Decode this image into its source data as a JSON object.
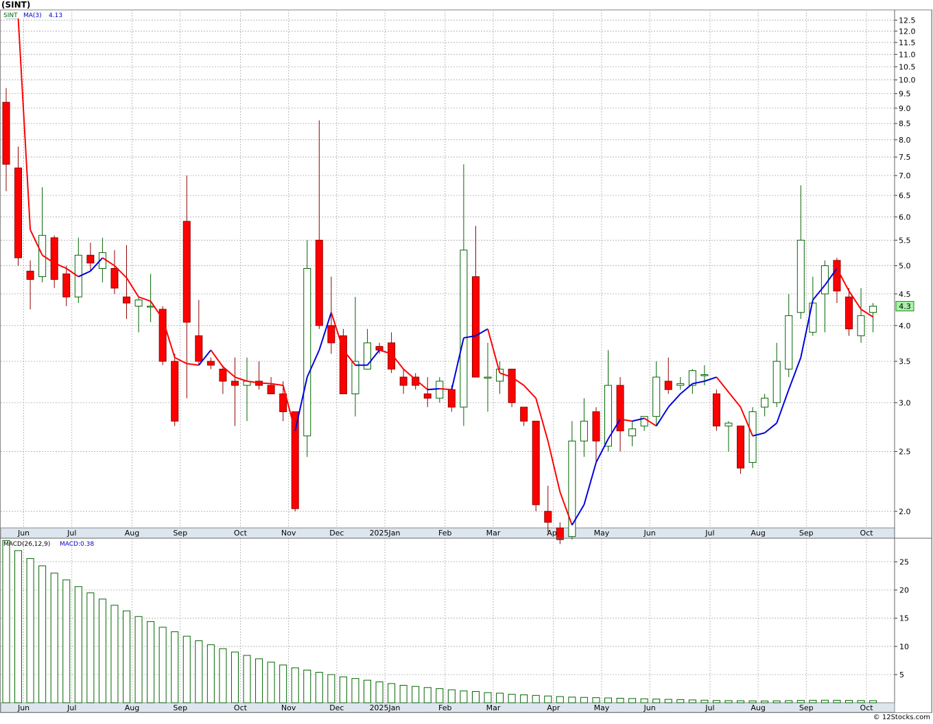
{
  "header": {
    "title": "(SINT)"
  },
  "footer": {
    "credit": "© 12Stocks.com"
  },
  "colors": {
    "up_fill": "#ffffff",
    "up_stroke": "#006400",
    "down_fill": "#ff0000",
    "down_stroke": "#8b0000",
    "ma_down": "#ff0000",
    "ma_up": "#0000dd",
    "macd_bar": "#006400",
    "grid": "#aaaaaa",
    "axis_bg": "#dde6ee",
    "last_price_bg": "#a8f0a8"
  },
  "chart_data": [
    {
      "type": "candlestick",
      "scale": "log",
      "legend": {
        "symbol": "SINT",
        "ma_label": "MA(3)",
        "ma_value": "4.13"
      },
      "last_price": "4.3",
      "ylim": [
        1.88,
        13.0
      ],
      "y_ticks": [
        "12.5",
        "12.0",
        "11.5",
        "11.0",
        "10.5",
        "10.0",
        "9.5",
        "9.0",
        "8.5",
        "8.0",
        "7.5",
        "7.0",
        "6.5",
        "6.0",
        "5.5",
        "5.0",
        "4.5",
        "4.0",
        "3.5",
        "3.0",
        "2.5",
        "2.0"
      ],
      "x_tick_labels": [
        "Jun",
        "Jul",
        "Aug",
        "Sep",
        "Oct",
        "Nov",
        "Dec",
        "2025Jan",
        "Feb",
        "Mar",
        "Apr",
        "May",
        "Jun",
        "Jul",
        "Aug",
        "Sep",
        "Oct"
      ],
      "x_tick_index": [
        1,
        5,
        10,
        14,
        19,
        23,
        27,
        31,
        36,
        40,
        45,
        49,
        53,
        58,
        62,
        66,
        71
      ],
      "candles": [
        {
          "o": 9.2,
          "h": 9.7,
          "l": 6.6,
          "c": 7.3
        },
        {
          "o": 7.2,
          "h": 7.8,
          "l": 5.0,
          "c": 5.15
        },
        {
          "o": 4.9,
          "h": 5.1,
          "l": 4.25,
          "c": 4.75
        },
        {
          "o": 4.8,
          "h": 6.7,
          "l": 4.7,
          "c": 5.6
        },
        {
          "o": 5.55,
          "h": 5.6,
          "l": 4.6,
          "c": 4.75
        },
        {
          "o": 4.85,
          "h": 5.0,
          "l": 4.3,
          "c": 4.45
        },
        {
          "o": 4.45,
          "h": 5.55,
          "l": 4.35,
          "c": 5.2
        },
        {
          "o": 5.2,
          "h": 5.45,
          "l": 4.9,
          "c": 5.05
        },
        {
          "o": 4.95,
          "h": 5.55,
          "l": 4.7,
          "c": 5.25
        },
        {
          "o": 4.95,
          "h": 5.3,
          "l": 4.5,
          "c": 4.6
        },
        {
          "o": 4.45,
          "h": 5.4,
          "l": 4.1,
          "c": 4.35
        },
        {
          "o": 4.3,
          "h": 4.45,
          "l": 3.9,
          "c": 4.4
        },
        {
          "o": 4.3,
          "h": 4.85,
          "l": 4.05,
          "c": 4.3
        },
        {
          "o": 4.25,
          "h": 4.3,
          "l": 3.45,
          "c": 3.5
        },
        {
          "o": 3.5,
          "h": 3.6,
          "l": 2.75,
          "c": 2.8
        },
        {
          "o": 5.9,
          "h": 7.0,
          "l": 3.05,
          "c": 4.05
        },
        {
          "o": 3.85,
          "h": 4.4,
          "l": 3.45,
          "c": 3.5
        },
        {
          "o": 3.5,
          "h": 3.55,
          "l": 3.4,
          "c": 3.45
        },
        {
          "o": 3.4,
          "h": 3.45,
          "l": 3.1,
          "c": 3.25
        },
        {
          "o": 3.25,
          "h": 3.55,
          "l": 2.75,
          "c": 3.2
        },
        {
          "o": 3.2,
          "h": 3.55,
          "l": 2.8,
          "c": 3.25
        },
        {
          "o": 3.25,
          "h": 3.5,
          "l": 3.15,
          "c": 3.2
        },
        {
          "o": 3.2,
          "h": 3.3,
          "l": 3.1,
          "c": 3.1
        },
        {
          "o": 3.1,
          "h": 3.25,
          "l": 2.8,
          "c": 2.9
        },
        {
          "o": 2.9,
          "h": 2.9,
          "l": 2.0,
          "c": 2.02
        },
        {
          "o": 2.65,
          "h": 5.5,
          "l": 2.45,
          "c": 4.95
        },
        {
          "o": 5.5,
          "h": 8.6,
          "l": 3.95,
          "c": 4.0
        },
        {
          "o": 4.0,
          "h": 4.8,
          "l": 3.6,
          "c": 3.75
        },
        {
          "o": 3.85,
          "h": 3.95,
          "l": 3.1,
          "c": 3.1
        },
        {
          "o": 3.1,
          "h": 4.45,
          "l": 2.85,
          "c": 3.5
        },
        {
          "o": 3.4,
          "h": 3.95,
          "l": 3.4,
          "c": 3.75
        },
        {
          "o": 3.7,
          "h": 3.75,
          "l": 3.6,
          "c": 3.65
        },
        {
          "o": 3.75,
          "h": 3.9,
          "l": 3.35,
          "c": 3.4
        },
        {
          "o": 3.3,
          "h": 3.4,
          "l": 3.1,
          "c": 3.2
        },
        {
          "o": 3.3,
          "h": 3.35,
          "l": 3.15,
          "c": 3.2
        },
        {
          "o": 3.1,
          "h": 3.3,
          "l": 2.95,
          "c": 3.05
        },
        {
          "o": 3.05,
          "h": 3.3,
          "l": 3.0,
          "c": 3.25
        },
        {
          "o": 3.15,
          "h": 3.2,
          "l": 2.9,
          "c": 2.95
        },
        {
          "o": 2.95,
          "h": 7.3,
          "l": 2.75,
          "c": 5.3
        },
        {
          "o": 4.8,
          "h": 5.8,
          "l": 3.3,
          "c": 3.3
        },
        {
          "o": 3.3,
          "h": 3.75,
          "l": 2.9,
          "c": 3.3
        },
        {
          "o": 3.25,
          "h": 3.5,
          "l": 3.1,
          "c": 3.4
        },
        {
          "o": 3.4,
          "h": 3.4,
          "l": 2.95,
          "c": 3.0
        },
        {
          "o": 2.95,
          "h": 2.95,
          "l": 2.75,
          "c": 2.8
        },
        {
          "o": 2.8,
          "h": 2.8,
          "l": 2.0,
          "c": 2.05
        },
        {
          "o": 2.0,
          "h": 2.2,
          "l": 1.85,
          "c": 1.92
        },
        {
          "o": 1.88,
          "h": 1.92,
          "l": 1.77,
          "c": 1.8
        },
        {
          "o": 1.82,
          "h": 2.8,
          "l": 1.8,
          "c": 2.6
        },
        {
          "o": 2.6,
          "h": 3.05,
          "l": 2.45,
          "c": 2.8
        },
        {
          "o": 2.9,
          "h": 2.95,
          "l": 2.4,
          "c": 2.6
        },
        {
          "o": 2.55,
          "h": 3.65,
          "l": 2.5,
          "c": 3.2
        },
        {
          "o": 3.2,
          "h": 3.3,
          "l": 2.5,
          "c": 2.7
        },
        {
          "o": 2.65,
          "h": 2.8,
          "l": 2.55,
          "c": 2.72
        },
        {
          "o": 2.75,
          "h": 2.85,
          "l": 2.7,
          "c": 2.85
        },
        {
          "o": 2.85,
          "h": 3.5,
          "l": 2.75,
          "c": 3.3
        },
        {
          "o": 3.25,
          "h": 3.55,
          "l": 3.1,
          "c": 3.15
        },
        {
          "o": 3.2,
          "h": 3.3,
          "l": 3.15,
          "c": 3.22
        },
        {
          "o": 3.2,
          "h": 3.4,
          "l": 3.1,
          "c": 3.38
        },
        {
          "o": 3.33,
          "h": 3.45,
          "l": 3.2,
          "c": 3.33
        },
        {
          "o": 3.1,
          "h": 3.15,
          "l": 2.7,
          "c": 2.75
        },
        {
          "o": 2.75,
          "h": 2.8,
          "l": 2.5,
          "c": 2.78
        },
        {
          "o": 2.75,
          "h": 2.75,
          "l": 2.3,
          "c": 2.35
        },
        {
          "o": 2.4,
          "h": 2.95,
          "l": 2.35,
          "c": 2.9
        },
        {
          "o": 2.95,
          "h": 3.1,
          "l": 2.85,
          "c": 3.05
        },
        {
          "o": 3.0,
          "h": 3.75,
          "l": 2.95,
          "c": 3.5
        },
        {
          "o": 3.4,
          "h": 4.5,
          "l": 3.3,
          "c": 4.15
        },
        {
          "o": 4.2,
          "h": 6.75,
          "l": 4.1,
          "c": 5.5
        },
        {
          "o": 3.9,
          "h": 4.8,
          "l": 3.85,
          "c": 4.35
        },
        {
          "o": 4.5,
          "h": 5.1,
          "l": 3.9,
          "c": 5.0
        },
        {
          "o": 5.1,
          "h": 5.15,
          "l": 4.35,
          "c": 4.55
        },
        {
          "o": 4.45,
          "h": 4.6,
          "l": 3.85,
          "c": 3.95
        },
        {
          "o": 3.85,
          "h": 4.6,
          "l": 3.75,
          "c": 4.15
        },
        {
          "o": 4.2,
          "h": 4.35,
          "l": 3.9,
          "c": 4.3
        }
      ],
      "ma3": [
        12.6,
        12.6,
        5.72,
        5.2,
        5.05,
        4.95,
        4.8,
        4.9,
        5.15,
        5.0,
        4.78,
        4.45,
        4.38,
        4.1,
        3.55,
        3.47,
        3.45,
        3.65,
        3.43,
        3.3,
        3.25,
        3.23,
        3.22,
        3.2,
        2.7,
        3.3,
        3.65,
        4.2,
        3.65,
        3.45,
        3.45,
        3.65,
        3.6,
        3.4,
        3.27,
        3.15,
        3.16,
        3.15,
        3.82,
        3.85,
        3.95,
        3.35,
        3.3,
        3.2,
        3.05,
        2.6,
        2.15,
        1.9,
        2.05,
        2.4,
        2.62,
        2.82,
        2.8,
        2.83,
        2.75,
        2.95,
        3.1,
        3.22,
        3.25,
        3.3,
        3.12,
        2.95,
        2.65,
        2.68,
        2.78,
        3.15,
        3.55,
        4.4,
        4.65,
        4.95,
        4.55,
        4.25,
        4.13
      ]
    },
    {
      "type": "bar",
      "legend": {
        "label": "MACD(26,12,9)",
        "value_label": "MACD:0.38"
      },
      "ylim": [
        0,
        29.2
      ],
      "y_ticks": [
        "25",
        "20",
        "15",
        "10",
        "5"
      ],
      "values": [
        28.8,
        27.0,
        25.6,
        24.3,
        23.0,
        21.8,
        20.6,
        19.5,
        18.4,
        17.3,
        16.3,
        15.3,
        14.4,
        13.4,
        12.6,
        11.8,
        11.0,
        10.3,
        9.6,
        9.0,
        8.4,
        7.8,
        7.2,
        6.7,
        6.2,
        5.8,
        5.4,
        5.0,
        4.6,
        4.3,
        4.0,
        3.7,
        3.4,
        3.1,
        2.9,
        2.7,
        2.5,
        2.3,
        2.1,
        2.0,
        1.8,
        1.7,
        1.5,
        1.4,
        1.3,
        1.2,
        1.1,
        1.0,
        0.95,
        0.9,
        0.85,
        0.8,
        0.75,
        0.7,
        0.65,
        0.6,
        0.55,
        0.5,
        0.45,
        0.4,
        0.38,
        0.36,
        0.34,
        0.32,
        0.35,
        0.38,
        0.42,
        0.44,
        0.45,
        0.44,
        0.42,
        0.4,
        0.38
      ],
      "x_tick_labels": [
        "Jun",
        "Jul",
        "Aug",
        "Sep",
        "Oct",
        "Nov",
        "Dec",
        "2025Jan",
        "Feb",
        "Mar",
        "Apr",
        "May",
        "Jun",
        "Jul",
        "Aug",
        "Sep",
        "Oct"
      ]
    }
  ]
}
